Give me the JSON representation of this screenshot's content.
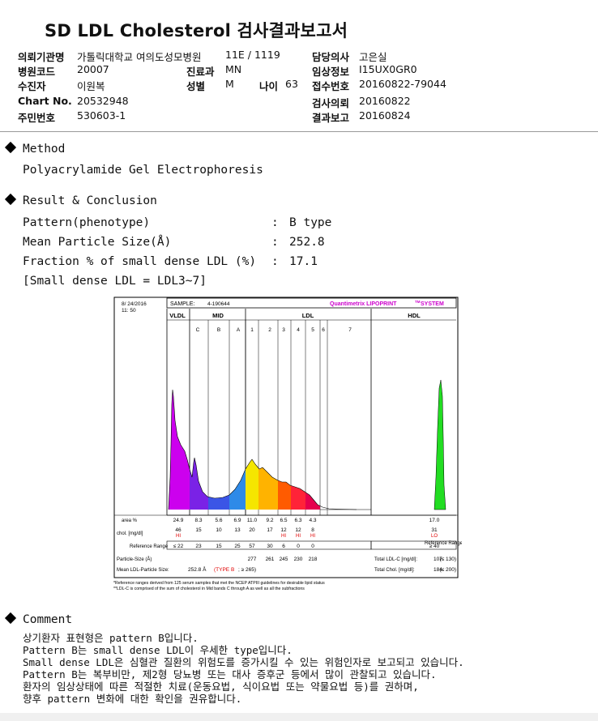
{
  "report": {
    "title": "SD LDL Cholesterol 검사결과보고서",
    "header": {
      "institution_label": "의뢰기관명",
      "institution_value": "가톨릭대학교 여의도성모병원",
      "ward_value": "11E / 1119",
      "doctor_label": "담당의사",
      "doctor_value": "고은실",
      "hospital_code_label": "병원코드",
      "hospital_code_value": "20007",
      "department_label": "진료과",
      "department_value": "MN",
      "clinical_info_label": "임상정보",
      "clinical_info_value": "I15UX0GR0",
      "patient_label": "수진자",
      "patient_value": "이원복",
      "sex_label": "성별",
      "sex_value": "M",
      "age_label": "나이",
      "age_value": "63",
      "receipt_label": "접수번호",
      "receipt_value": "20160822-79044",
      "chart_no_label": "Chart No.",
      "chart_no_value": "20532948",
      "test_request_label": "검사의뢰",
      "test_request_value": "20160822",
      "resident_no_label": "주민번호",
      "resident_no_value": "530603-1",
      "result_report_label": "결과보고",
      "result_report_value": "20160824"
    }
  },
  "method": {
    "heading": "Method",
    "text": "Polyacrylamide Gel Electrophoresis"
  },
  "result": {
    "heading": "Result & Conclusion",
    "rows": [
      {
        "label": "Pattern(phenotype)",
        "colon": ":",
        "value": "B type"
      },
      {
        "label": "Mean Particle Size(Å)",
        "colon": ":",
        "value": "252.8"
      },
      {
        "label": "Fraction % of small dense LDL (%)",
        "colon": ":",
        "value": "17.1"
      }
    ],
    "note": "[Small dense LDL = LDL3~7]"
  },
  "chart_data": {
    "type": "area",
    "date": "8/ 24/2016",
    "time": "11: 50",
    "sample_label": "SAMPLE:",
    "sample_value": "4-190644",
    "brand": "Quantimetrix LIPOPRINT",
    "brand_tm": "TM",
    "brand_suffix": "SYSTEM",
    "groups": [
      "VLDL",
      "MID",
      "LDL",
      "HDL"
    ],
    "bands": [
      "C",
      "B",
      "A",
      "1",
      "2",
      "3",
      "4",
      "5",
      "6",
      "7"
    ],
    "row_labels": {
      "area": "area %",
      "chol": "chol. [mg/dl]",
      "ref": "Reference Range",
      "ref_right": "Reference Range",
      "particle": "Particle-Size (Å)",
      "mean": "Mean LDL-Particle Size:"
    },
    "area_pct": [
      "24.9",
      "8.3",
      "5.6",
      "6.9",
      "11.0",
      "9.2",
      "6.5",
      "6.3",
      "4.3",
      "17.0"
    ],
    "chol": [
      "46",
      "15",
      "10",
      "13",
      "20",
      "17",
      "12",
      "12",
      "8",
      "31"
    ],
    "flags": [
      "HI",
      "HI",
      "HI",
      "HI",
      "LO"
    ],
    "reference": [
      "≤ 22",
      "23",
      "15",
      "25",
      "57",
      "30",
      "6",
      "0",
      "0",
      "≥ 40"
    ],
    "particle_size": [
      "277",
      "261",
      "245",
      "230",
      "218"
    ],
    "total_ldlc_label": "Total LDL-C [mg/dl]:",
    "total_ldlc_value": "107",
    "total_ldlc_ref": "(≤ 130)",
    "total_chol_label": "Total Chol. [mg/dl]:",
    "total_chol_value": "184",
    "total_chol_ref": "(≤ 200)",
    "mean_size_value": "252.8 Å",
    "mean_type": "(TYPE B",
    "mean_ref": "; ≥ 265)",
    "footnote1": "*Reference ranges derived from 125 serum samples that met the NCEP ATPIII guidelines for desirable lipid status",
    "footnote2": "**LDL-C is comprised of the sum of cholesterol in Mid bands C through A as well as all the subfractions",
    "colors": {
      "vldl": "#cc00ee",
      "mid_c": "#7a22e6",
      "mid_b": "#3b55e6",
      "mid_a": "#2e8ae8",
      "ldl1": "#f5e600",
      "ldl2": "#ffb300",
      "ldl3": "#ff5b00",
      "ldl4": "#ff2338",
      "ldl5": "#e5004d",
      "hdl": "#22dd22",
      "brand": "#cc00cc",
      "flag": "#e00000"
    }
  },
  "comment": {
    "heading": "Comment",
    "lines": [
      "상기환자 표현형은 pattern B입니다.",
      "Pattern B는 small dense LDL이 우세한 type입니다.",
      "Small dense LDL은 심혈관 질환의 위험도를 증가시킬 수 있는 위험인자로 보고되고 있습니다.",
      "Pattern B는 복부비만, 제2형 당뇨병 또는 대사 증후군 등에서 많이 관찰되고 있습니다.",
      "환자의 임상상태에 따른 적절한 치료(운동요법, 식이요법 또는 약물요법 등)를 권하며,",
      "향후 pattern 변화에 대한 확인을 권유합니다."
    ]
  }
}
